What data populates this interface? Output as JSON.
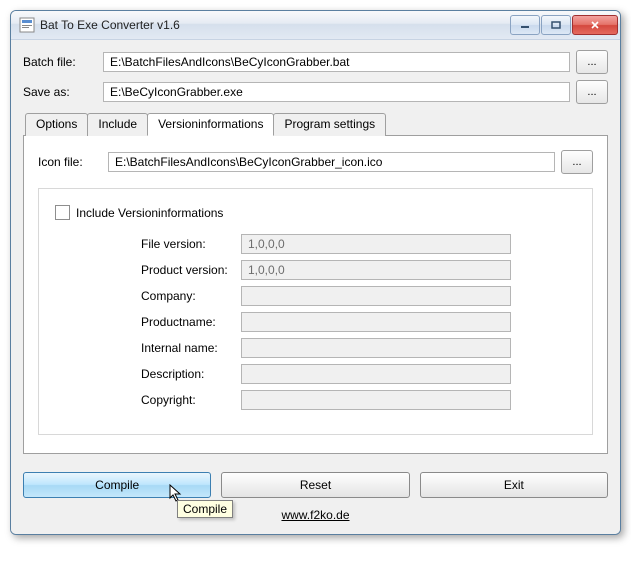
{
  "window": {
    "title": "Bat To Exe Converter v1.6"
  },
  "files": {
    "batch_label": "Batch file:",
    "batch_value": "E:\\BatchFilesAndIcons\\BeCyIconGrabber.bat",
    "saveas_label": "Save as:",
    "saveas_value": "E:\\BeCyIconGrabber.exe",
    "browse_label": "..."
  },
  "tabs": {
    "options": "Options",
    "include": "Include",
    "versioninfo": "Versioninformations",
    "programsettings": "Program settings"
  },
  "panel": {
    "icon_label": "Icon file:",
    "icon_value": "E:\\BatchFilesAndIcons\\BeCyIconGrabber_icon.ico",
    "include_check": "Include Versioninformations",
    "fields": {
      "file_version_label": "File version:",
      "file_version_value": "1,0,0,0",
      "product_version_label": "Product version:",
      "product_version_value": "1,0,0,0",
      "company_label": "Company:",
      "company_value": "",
      "productname_label": "Productname:",
      "productname_value": "",
      "internalname_label": "Internal name:",
      "internalname_value": "",
      "description_label": "Description:",
      "description_value": "",
      "copyright_label": "Copyright:",
      "copyright_value": ""
    }
  },
  "buttons": {
    "compile": "Compile",
    "reset": "Reset",
    "exit": "Exit"
  },
  "tooltip": "Compile",
  "footer": "www.f2ko.de"
}
